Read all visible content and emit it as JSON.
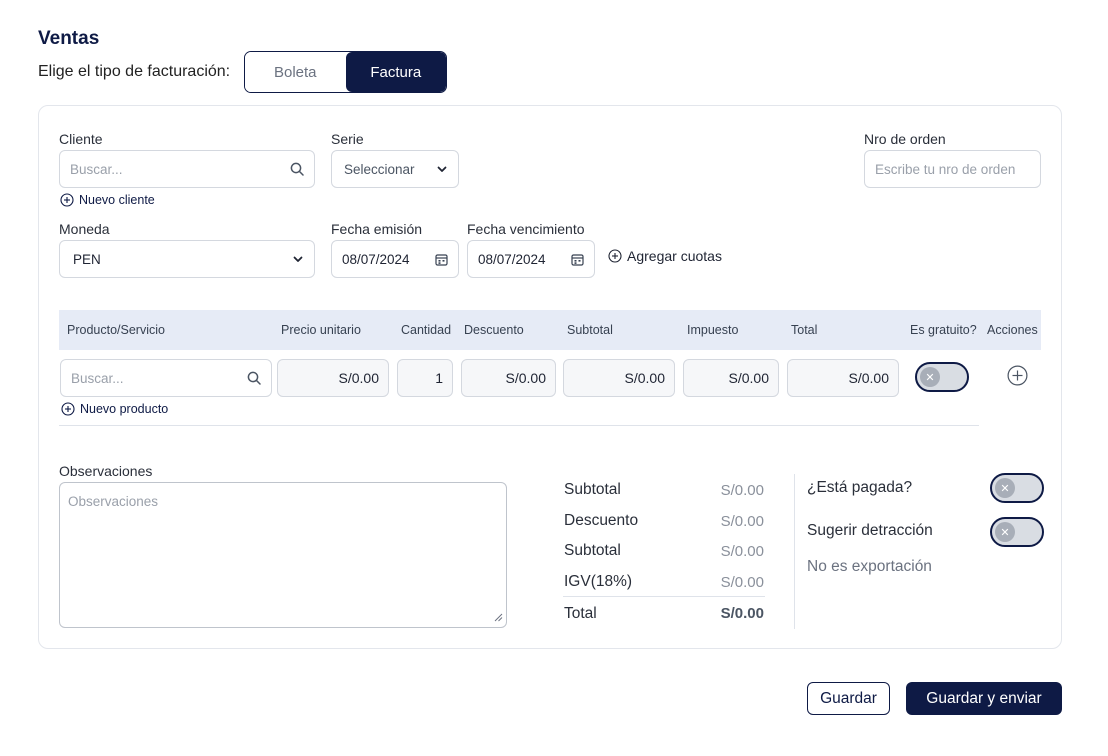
{
  "header": {
    "title": "Ventas",
    "billing_type_label": "Elige el tipo de facturación:",
    "billing_options": [
      "Boleta",
      "Factura"
    ],
    "billing_selected": "Factura"
  },
  "form": {
    "cliente": {
      "label": "Cliente",
      "placeholder": "Buscar...",
      "new_link": "Nuevo cliente"
    },
    "serie": {
      "label": "Serie",
      "value": "Seleccionar"
    },
    "nro_orden": {
      "label": "Nro de orden",
      "placeholder": "Escribe tu nro de orden"
    },
    "moneda": {
      "label": "Moneda",
      "value": "PEN"
    },
    "fecha_emision": {
      "label": "Fecha emisión",
      "value": "08/07/2024"
    },
    "fecha_vencimiento": {
      "label": "Fecha vencimiento",
      "value": "08/07/2024"
    },
    "agregar_cuotas": "Agregar cuotas"
  },
  "table": {
    "headers": [
      "Producto/Servicio",
      "Precio unitario",
      "Cantidad",
      "Descuento",
      "Subtotal",
      "Impuesto",
      "Total",
      "Es gratuito?",
      "Acciones"
    ],
    "row": {
      "product_placeholder": "Buscar...",
      "precio_unitario": "S/0.00",
      "cantidad": "1",
      "descuento": "S/0.00",
      "subtotal": "S/0.00",
      "impuesto": "S/0.00",
      "total": "S/0.00",
      "es_gratuito": false
    },
    "new_product_link": "Nuevo producto"
  },
  "observaciones": {
    "label": "Observaciones",
    "placeholder": "Observaciones"
  },
  "summary": [
    {
      "label": "Subtotal",
      "value": "S/0.00"
    },
    {
      "label": "Descuento",
      "value": "S/0.00"
    },
    {
      "label": "Subtotal",
      "value": "S/0.00"
    },
    {
      "label": "IGV(18%)",
      "value": "S/0.00"
    }
  ],
  "summary_total": {
    "label": "Total",
    "value": "S/0.00"
  },
  "flags": {
    "pagada_label": "¿Está pagada?",
    "pagada": false,
    "detraccion_label": "Sugerir detracción",
    "detraccion": false,
    "exportacion_text": "No es exportación"
  },
  "actions": {
    "save": "Guardar",
    "save_send": "Guardar y enviar"
  },
  "colors": {
    "primary": "#0e1a45",
    "table_header_bg": "#e6ebf6",
    "border": "#d4d8df"
  },
  "icons": [
    "search-icon",
    "chevron-down-icon",
    "calendar-icon",
    "plus-circle-icon",
    "close-icon",
    "resize-handle-icon"
  ]
}
